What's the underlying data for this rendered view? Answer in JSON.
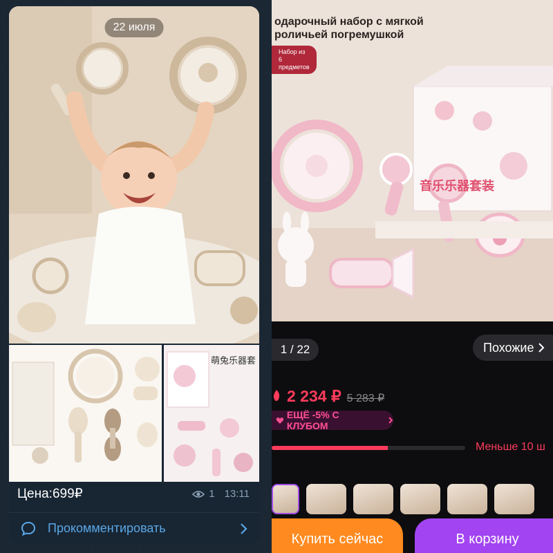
{
  "left_panel": {
    "date_chip": "22 июля",
    "caption": "Цена:699₽",
    "views": "1",
    "time": "13:11",
    "comment_label": "Прокомментировать",
    "thumb_text": "萌兔乐器套"
  },
  "right_panel": {
    "promo_title": "одарочный набор с мягкой роличьей погремушкой",
    "promo_badge": "Набор из 6 предметов",
    "box_text": "音乐乐器套装",
    "image_counter": "1 / 22",
    "similar_label": "Похожие",
    "price": "2 234 ₽",
    "old_price": "5 283 ₽",
    "club_text": "ЕЩЁ -5% С КЛУБОМ",
    "stock_text": "Меньше 10 ш",
    "stock_level": 0.6,
    "buy_now_label": "Купить сейчас",
    "cart_label": "В корзину"
  },
  "colors": {
    "telegram_bg": "#1b2733",
    "link_blue": "#5aa7e6",
    "price_red": "#ff3b5c",
    "club_pink": "#ff4f93",
    "buy_orange": "#ff8a1f",
    "cart_purple": "#a244f2"
  }
}
